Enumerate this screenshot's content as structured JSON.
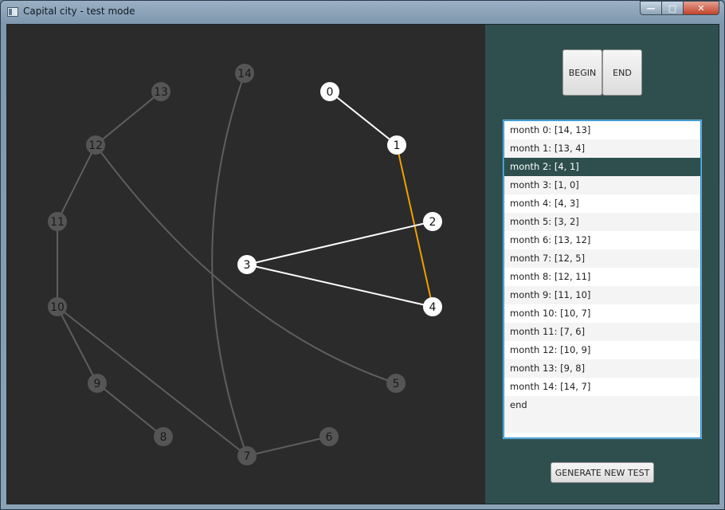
{
  "window": {
    "title": "Capital city - test mode",
    "controls": {
      "minimize": "—",
      "maximize": "□",
      "close": "✕"
    }
  },
  "colors": {
    "canvas_bg": "#2b2b2b",
    "panel_bg": "#2f4f4f",
    "inactive_node": "#555555",
    "inactive_edge": "#5e5e5e",
    "active_node": "#ffffff",
    "active_edge": "#ffffff",
    "highlight_edge": "#f0a000"
  },
  "graph": {
    "nodes": [
      {
        "id": "0",
        "active": true
      },
      {
        "id": "1",
        "active": true
      },
      {
        "id": "2",
        "active": true
      },
      {
        "id": "3",
        "active": true
      },
      {
        "id": "4",
        "active": true
      },
      {
        "id": "5",
        "active": false
      },
      {
        "id": "6",
        "active": false
      },
      {
        "id": "7",
        "active": false
      },
      {
        "id": "8",
        "active": false
      },
      {
        "id": "9",
        "active": false
      },
      {
        "id": "10",
        "active": false
      },
      {
        "id": "11",
        "active": false
      },
      {
        "id": "12",
        "active": false
      },
      {
        "id": "13",
        "active": false
      },
      {
        "id": "14",
        "active": false
      }
    ],
    "edges": [
      {
        "from": "0",
        "to": "1",
        "state": "active"
      },
      {
        "from": "1",
        "to": "4",
        "state": "highlight"
      },
      {
        "from": "3",
        "to": "2",
        "state": "active"
      },
      {
        "from": "3",
        "to": "4",
        "state": "active"
      },
      {
        "from": "12",
        "to": "13",
        "state": "inactive"
      },
      {
        "from": "12",
        "to": "11",
        "state": "inactive"
      },
      {
        "from": "11",
        "to": "10",
        "state": "inactive"
      },
      {
        "from": "10",
        "to": "9",
        "state": "inactive"
      },
      {
        "from": "9",
        "to": "8",
        "state": "inactive"
      },
      {
        "from": "10",
        "to": "7",
        "state": "inactive"
      },
      {
        "from": "7",
        "to": "6",
        "state": "inactive"
      },
      {
        "from": "14",
        "to": "7",
        "state": "inactive"
      },
      {
        "from": "12",
        "to": "5",
        "state": "inactive"
      }
    ]
  },
  "controls": {
    "begin_label": "BEGIN",
    "end_label": "END",
    "generate_label": "GENERATE NEW TEST"
  },
  "months": {
    "selected_index": 2,
    "items": [
      "month 0: [14, 13]",
      "month 1: [13, 4]",
      "month 2: [4, 1]",
      "month 3: [1, 0]",
      "month 4: [4, 3]",
      "month 5: [3, 2]",
      "month 6: [13, 12]",
      "month 7: [12, 5]",
      "month 8: [12, 11]",
      "month 9: [11, 10]",
      "month 10: [10, 7]",
      "month 11: [7, 6]",
      "month 12: [10, 9]",
      "month 13: [9, 8]",
      "month 14: [14, 7]",
      "end"
    ]
  }
}
